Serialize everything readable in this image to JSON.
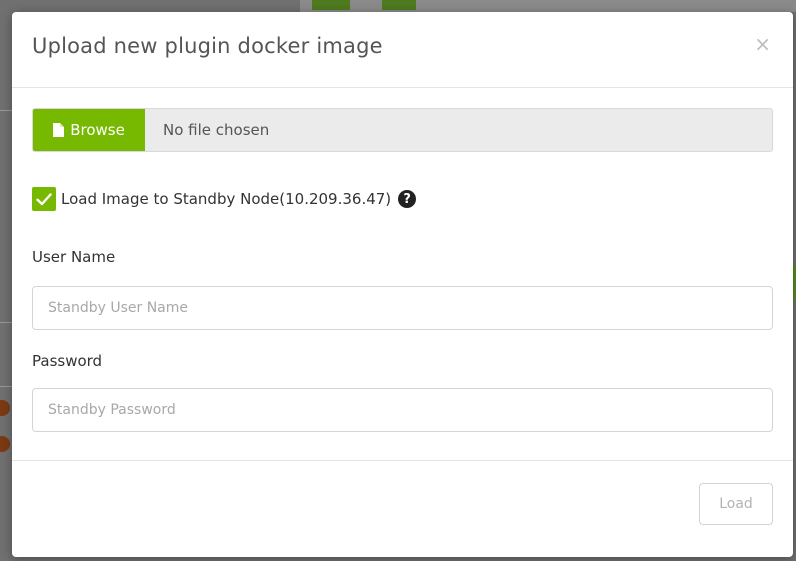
{
  "modal": {
    "title": "Upload new plugin docker image",
    "close_glyph": "×"
  },
  "file_input": {
    "browse_label": "Browse",
    "status": "No file chosen",
    "icon": "file-icon"
  },
  "standby": {
    "checked": true,
    "label": "Load Image to Standby Node(10.209.36.47)",
    "help_glyph": "?"
  },
  "username": {
    "label": "User Name",
    "placeholder": "Standby User Name",
    "value": ""
  },
  "password": {
    "label": "Password",
    "placeholder": "Standby Password",
    "value": ""
  },
  "footer": {
    "load_label": "Load",
    "load_enabled": false
  },
  "colors": {
    "accent": "#76b900",
    "title": "#555555",
    "disabled_text": "#b3b3b3"
  }
}
